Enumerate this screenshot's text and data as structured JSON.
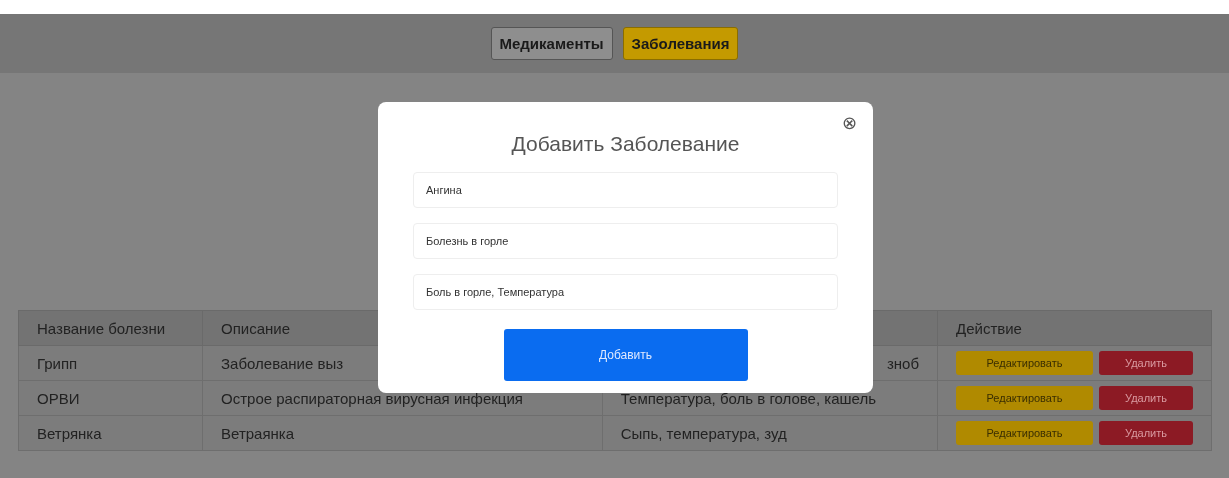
{
  "nav": {
    "tabs": [
      {
        "label": "Медикаменты",
        "selected": false
      },
      {
        "label": "Заболевания",
        "selected": true
      }
    ]
  },
  "table": {
    "columns": [
      "Название болезни",
      "Описание",
      "Действие"
    ],
    "rows": [
      {
        "name": "Грипп",
        "description": "Заболевание выз",
        "symptoms": "зноб",
        "symptoms_covered_start": true,
        "actions": [
          "Редактировать",
          "Удалить"
        ]
      },
      {
        "name": "ОРВИ",
        "description": "Острое распираторная вирусная инфекция",
        "symptoms": "Температура, боль в голове, кашель",
        "symptoms_covered_start": false,
        "actions": [
          "Редактировать",
          "Удалить"
        ]
      },
      {
        "name": "Ветрянка",
        "description": "Ветраянка",
        "symptoms": "Сыпь, температура, зуд",
        "symptoms_covered_start": false,
        "actions": [
          "Редактировать",
          "Удалить"
        ]
      }
    ]
  },
  "modal": {
    "title": "Добавить Заболевание",
    "close": "⊗",
    "fields": [
      {
        "value": "Ангина"
      },
      {
        "value": "Болезнь в горле"
      },
      {
        "value": "Боль в горле, Температура"
      }
    ],
    "submit": "Добавить"
  }
}
